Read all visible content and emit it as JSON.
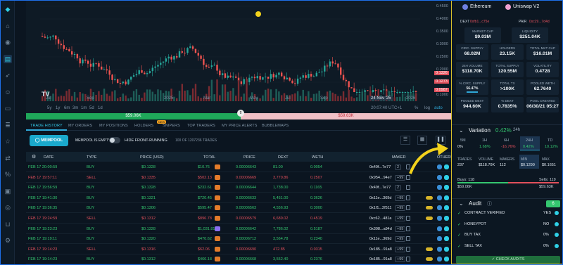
{
  "nav_icons": [
    "logo-icon",
    "home-icon",
    "eye-icon",
    "chart-icon",
    "rocket-icon",
    "users-icon",
    "wallet-icon",
    "layers-icon",
    "star-icon",
    "swap-icon",
    "percent-icon",
    "image-icon",
    "globe-icon",
    "cart-icon",
    "gear-icon"
  ],
  "chart": {
    "y_ticks": [
      "0.4500",
      "0.4000",
      "0.3500",
      "0.3000",
      "0.2500",
      "0.2000",
      "0.1500",
      "0.1000"
    ],
    "x_ticks": [
      "Jul",
      "Sep",
      "2025",
      "Mar",
      "May",
      "Jul",
      "Sep",
      "24 Nov '25",
      "2026"
    ],
    "price_tags": [
      "0.1326",
      "0.1273",
      "0.0987"
    ],
    "ranges": [
      "5y",
      "1y",
      "6m",
      "3m",
      "1m",
      "5d",
      "1d"
    ],
    "clock": "20:07:40 UTC+1",
    "scale_opts": [
      "%",
      "log",
      "auto"
    ],
    "progress_buy": "$59.06K",
    "progress_sell": "$59.63K"
  },
  "tabs": [
    "TRADE HISTORY",
    "MY ORDERS",
    "MY POSITIONS",
    "HOLDERS",
    "SNIPERS",
    "TOP TRADERS",
    "MY PRICE ALERTS",
    "BUBBLEMAPS"
  ],
  "new_tag": "NEW",
  "controls": {
    "mempool": "MEMPOOL",
    "mempool_empty": "MEMPOOL IS EMPTY",
    "hide_fr": "HIDE FRONT-RUNNING",
    "count": "100 OF 1207236 TRADES"
  },
  "table": {
    "headers": [
      "DATE",
      "TYPE",
      "PRICE (USD)",
      "TOTAL",
      "PRICE",
      "DEXT",
      "WETH",
      "MAKER",
      "OTHERS"
    ],
    "rows": [
      {
        "date": "FEB 17 20:00:59",
        "type": "BUY",
        "price": "$0.1328",
        "total": "$10.76",
        "p": "0.00006643",
        "dext": "81.00",
        "weth": "0.0054",
        "maker": "0x49f...7e77",
        "badge": "2"
      },
      {
        "date": "FEB 17 19:57:11",
        "type": "SELL",
        "price": "$0.1335",
        "total": "$502.13",
        "p": "0.00006669",
        "dext": "3,770.86",
        "weth": "0.2507",
        "maker": "0x954...94e7",
        "badge": "+99"
      },
      {
        "date": "FEB 17 19:56:59",
        "type": "BUY",
        "price": "$0.1328",
        "total": "$232.61",
        "p": "0.00006644",
        "dext": "1,738.00",
        "weth": "0.1165",
        "maker": "0x49f...7e77",
        "badge": "2"
      },
      {
        "date": "FEB 17 19:41:30",
        "type": "BUY",
        "price": "$0.1321",
        "total": "$720.45",
        "p": "0.00006633",
        "dext": "5,451.00",
        "weth": "0.3626",
        "maker": "0x11e...369d",
        "badge": "+99"
      },
      {
        "date": "FEB 17 19:36:35",
        "type": "BUY",
        "price": "$0.1306",
        "total": "$595.47",
        "p": "0.00006563",
        "dext": "4,556.93",
        "weth": "0.3000",
        "maker": "0x1f1...2f511",
        "badge": "+99"
      },
      {
        "date": "FEB 17 19:24:59",
        "type": "SELL",
        "price": "$0.1312",
        "total": "$896.78",
        "p": "0.00006579",
        "dext": "6,689.02",
        "weth": "0.4519",
        "maker": "0xc62...481a",
        "badge": "+99"
      },
      {
        "date": "FEB 17 19:23:23",
        "type": "BUY",
        "price": "$0.1328",
        "total": "$1,031.81",
        "p": "0.00006642",
        "dext": "7,786.02",
        "weth": "0.5187",
        "maker": "0x398...a94d",
        "badge": "+99"
      },
      {
        "date": "FEB 17 19:19:11",
        "type": "BUY",
        "price": "$0.1320",
        "total": "$470.62",
        "p": "0.00006712",
        "dext": "3,564.78",
        "weth": "0.2340",
        "maker": "0x11e...369d",
        "badge": "+99"
      },
      {
        "date": "FEB 17 19:14:23",
        "type": "SELL",
        "price": "$0.1316",
        "total": "$62.06",
        "p": "0.00006690",
        "dext": "472.85",
        "weth": "0.0315",
        "maker": "0x185...91a8",
        "badge": "+99"
      },
      {
        "date": "FEB 17 19:14:23",
        "type": "BUY",
        "price": "$0.1312",
        "total": "$466.18",
        "p": "0.00006668",
        "dext": "3,552.40",
        "weth": "0.2376",
        "maker": "0x185...91a8",
        "badge": "+99"
      }
    ]
  },
  "side": {
    "chain": "Ethereum",
    "dex": "Uniswap V2",
    "dext_label": "DEXT",
    "dext_addr": "0xfb1...c75e",
    "pair_label": "PAIR",
    "pair_addr": "0xc29...7d4d",
    "stats": [
      [
        "MARKET CAP",
        "$9.03M"
      ],
      [
        "LIQUIDITY",
        "$251.04K"
      ],
      [
        "CIRC. SUPPLY",
        "68.02M"
      ],
      [
        "HOLDERS",
        "23.15K"
      ],
      [
        "TOTAL MKT CAP",
        "$16.01M"
      ],
      [
        "24H VOLUME",
        "$118.70K"
      ],
      [
        "TOTAL SUPPLY",
        "120.55M"
      ],
      [
        "VOLATILITY",
        "0.4728"
      ],
      [
        "% CIRC. SUPPLY",
        "56.47%"
      ],
      [
        "TOTAL TX",
        ">100K"
      ],
      [
        "POOLED WETH",
        "62.7640"
      ],
      [
        "POOLED DEXT",
        "944.60K"
      ],
      [
        "% DEXT",
        "0.7835%"
      ],
      [
        "POOL CREATED",
        "06/30/21 05:27"
      ]
    ],
    "variation_label": "Variation",
    "variation_pct": "0.42%",
    "variation_tf": "24h",
    "periods": [
      [
        "5M",
        "0%"
      ],
      [
        "1H",
        "1.68%"
      ],
      [
        "6H",
        "-16.76%"
      ],
      [
        "24H",
        "0.42%"
      ],
      [
        "TD",
        "10.12%"
      ]
    ],
    "vol_headers": [
      "TRADES",
      "VOLUME",
      "MAKERS",
      "MIN",
      "MAX"
    ],
    "vol_values": [
      "237",
      "$118.70K",
      "112",
      "$0.1299",
      "$0.1651"
    ],
    "buys": "Buys: 118",
    "sells": "Sells: 119",
    "buy_total": "$59.06K",
    "sell_total": "$59.63K",
    "audit_label": "Audit",
    "audit_score": "6",
    "audits": [
      [
        "CONTRACT VERIFIED",
        "YES"
      ],
      [
        "HONEYPOT",
        "NO"
      ],
      [
        "BUY TAX",
        "0%"
      ],
      [
        "SELL TAX",
        "0%"
      ]
    ],
    "check_btn": "CHECK AUDITS"
  },
  "colors": {
    "accent": "#1e6fe8",
    "buy": "#35c770",
    "sell": "#e2505c",
    "yellow": "#f2d21c"
  }
}
